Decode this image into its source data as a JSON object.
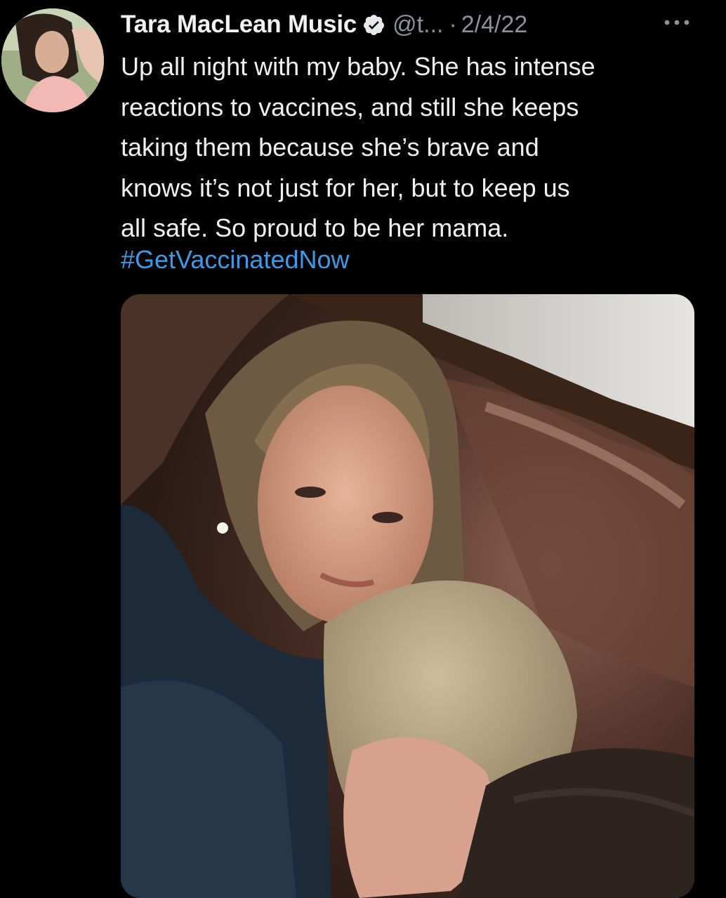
{
  "tweet": {
    "author": {
      "display_name": "Tara MacLean Music",
      "handle": "@t...",
      "verified": true,
      "avatar_icon": "profile-avatar"
    },
    "separator": "·",
    "date": "2/4/22",
    "more_icon": "more-horizontal-icon",
    "text_lines": [
      "Up all night with my baby. She has intense",
      "reactions to vaccines, and still she keeps",
      "taking them because she’s brave and",
      "knows it’s not just for her, but to keep us",
      "all safe. So proud to be her mama."
    ],
    "hashtag": "#GetVaccinatedNow",
    "media": {
      "type": "photo"
    }
  },
  "colors": {
    "background": "#000000",
    "text": "#f0f0f0",
    "muted": "#8b9298",
    "link": "#3b9be8"
  }
}
